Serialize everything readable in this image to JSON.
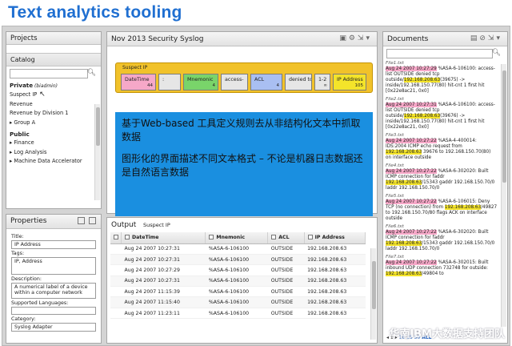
{
  "slide_title": "Text analytics tooling",
  "projects": {
    "title": "Projects"
  },
  "catalog": {
    "title": "Catalog",
    "groups": [
      {
        "label": "Private",
        "note": "(biadmin)",
        "items": [
          "Suspect IP",
          "Revenue",
          "Revenue by Division 1",
          "▸ Group A"
        ]
      },
      {
        "label": "Public",
        "items": [
          "▸ Finance",
          "▸ Log Analysis",
          "▸ Machine Data Accelerator"
        ]
      }
    ]
  },
  "properties": {
    "title": "Properties",
    "fields": [
      {
        "label": "Title:",
        "value": "IP Address"
      },
      {
        "label": "Tags:",
        "value": "IP, Address"
      },
      {
        "label": "Description:",
        "value": "A numerical label of a device within a computer network"
      },
      {
        "label": "Supported Languages:",
        "value": ""
      },
      {
        "label": "Category:",
        "value": "Syslog Adapter"
      }
    ]
  },
  "editor": {
    "title": "Nov 2013 Security Syslog",
    "expression_label": "Suspect IP",
    "tokens": [
      {
        "text": "DateTime",
        "num": "44",
        "color": "#f6a8c8"
      },
      {
        "text": ":",
        "num": "",
        "color": "#e6e6e6"
      },
      {
        "text": "Mnemonic",
        "num": "4",
        "color": "#79d46a"
      },
      {
        "text": "access-",
        "num": "",
        "color": "#e6e6e6"
      },
      {
        "text": "ACL",
        "num": "4",
        "color": "#a9bff2"
      },
      {
        "text": "denied tcp",
        "num": "",
        "color": "#e6e6e6"
      },
      {
        "text": "1-2",
        "num": "∞",
        "color": "#e6e6e6"
      },
      {
        "text": "IP Address",
        "num": "105",
        "color": "#f4e42a"
      }
    ],
    "overlay_lines": [
      "基于Web-based 工具定义规则去从非结构化文本中抓取数据",
      "图形化的界面描述不同文本格式 – 不论是机器日志数据还是自然语言数据"
    ]
  },
  "output": {
    "title": "Output",
    "subtitle": "Suspect IP",
    "columns": [
      "DateTime",
      "Mnemonic",
      "ACL",
      "IP Address"
    ],
    "rows": [
      [
        "Aug 24 2007 10:27:31",
        "%ASA-6-106100",
        "OUTSIDE",
        "192.168.208.63"
      ],
      [
        "Aug 24 2007 10:27:31",
        "%ASA-6-106100",
        "OUTSIDE",
        "192.168.208.63"
      ],
      [
        "Aug 24 2007 10:27:29",
        "%ASA-6-106100",
        "OUTSIDE",
        "192.168.208.63"
      ],
      [
        "Aug 24 2007 10:27:31",
        "%ASA-6-106100",
        "OUTSIDE",
        "192.168.208.63"
      ],
      [
        "Aug 24 2007 11:15:39",
        "%ASA-6-106100",
        "OUTSIDE",
        "192.168.208.63"
      ],
      [
        "Aug 24 2007 11:15:40",
        "%ASA-6-106100",
        "OUTSIDE",
        "192.168.208.63"
      ],
      [
        "Aug 24 2007 11:23:11",
        "%ASA-6-106100",
        "OUTSIDE",
        "192.168.208.63"
      ]
    ]
  },
  "documents": {
    "title": "Documents",
    "files": [
      {
        "name": "File1.txt",
        "text": "Aug 24 2007 10:27:29 %ASA-6-106100: access-list OUTSIDE denied tcp outside/192.168.208.63(39675) -> inside/192.168.150.77(80) hit-cnt 1 first hit [0x22e8ac21, 0x0]"
      },
      {
        "name": "File2.txt",
        "text": "Aug 24 2007 10:27:31 %ASA-6-106100: access-list OUTSIDE denied tcp outside/192.168.208.63(39676) -> inside/192.168.150.77(80) hit-cnt 1 first hit [0x22e8ac21, 0x0]"
      },
      {
        "name": "File3.txt",
        "text": "Aug 24 2007 10:27:22 %ASA-4-400014: IDS:2004 ICMP echo request from 192.168.208.63 39676 to 192.168.150.70(80) on interface outside"
      },
      {
        "name": "File4.txt",
        "text": "Aug 24 2007 10:27:22 %ASA-6-302020: Built ICMP connection for faddr 192.168.208.63/15343 gaddr 192.168.150.70/0 laddr 192.168.150.70/0"
      },
      {
        "name": "File5.txt",
        "text": "Aug 24 2007 10:27:22 %ASA-6-106015: Deny TCP (no connection) from 192.168.208.63/49827 to 192.168.150.70/80 flags ACK on interface outside"
      },
      {
        "name": "File6.txt",
        "text": "Aug 24 2007 10:27:22 %ASA-6-302020: Built ICMP connection for faddr 192.168.208.63/15343 gaddr 192.168.150.70/0 laddr 192.168.150.70/0"
      },
      {
        "name": "File7.txt",
        "text": "Aug 24 2007 10:27:22 %ASA-6-302015: Built inbound UDP connection 732748 for outside: 192.168.208.63/49804 to"
      }
    ],
    "pager": {
      "prev": "◂",
      "page": "1",
      "next": "▸",
      "sizes": [
        "10",
        "25",
        "50",
        "ALL"
      ]
    }
  },
  "watermark": "华南IBM大数据支持团队",
  "icons": [
    "search-icon",
    "save-icon",
    "grid-icon",
    "filter-icon",
    "menu-icon",
    "cursor-icon"
  ]
}
